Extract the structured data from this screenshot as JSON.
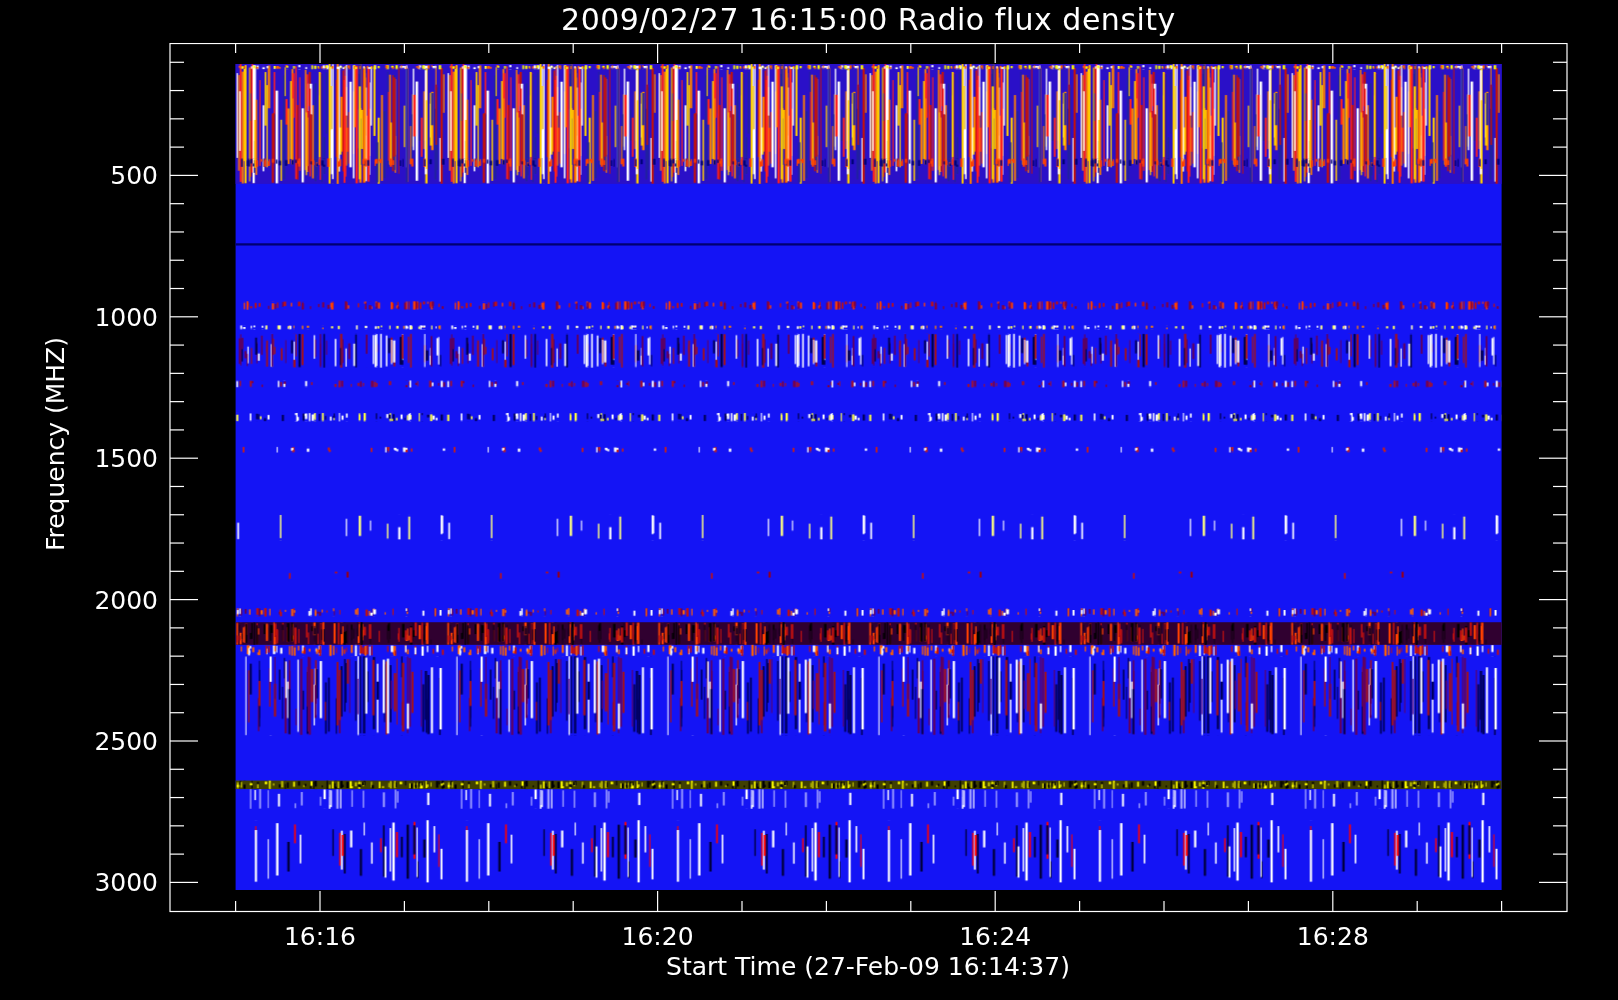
{
  "title": "2009/02/27 16:15:00 Radio flux density",
  "plot": {
    "ylabel": "Frequency (MHZ)",
    "xlabel": "Start Time (27-Feb-09 16:14:37)",
    "yticks": [
      "500",
      "1000",
      "1500",
      "2000",
      "2500",
      "3000"
    ],
    "xticks": [
      "16:16",
      "16:20",
      "16:24",
      "16:28"
    ]
  }
}
